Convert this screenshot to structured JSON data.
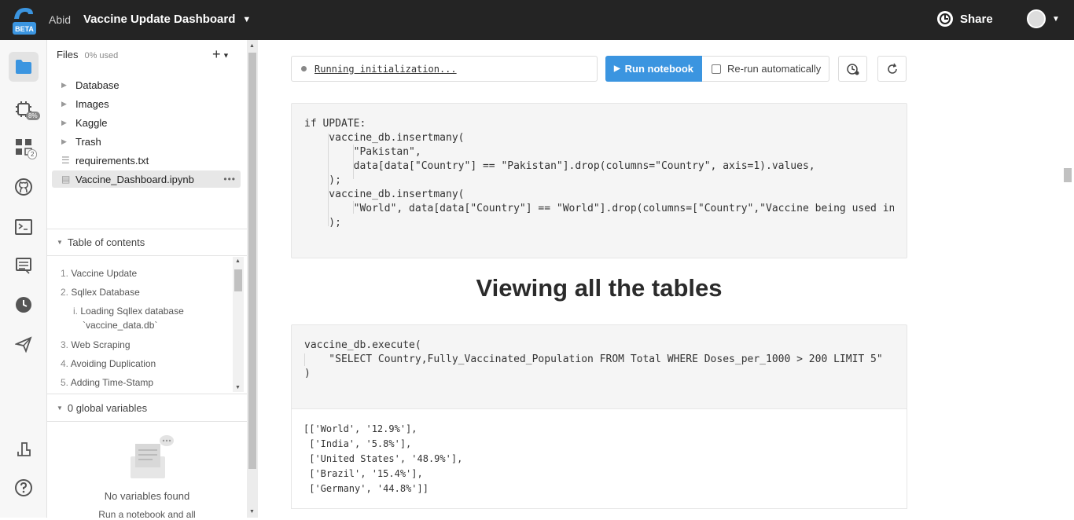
{
  "topbar": {
    "logo_label": "BETA",
    "user": "Abid",
    "doc_title": "Vaccine Update Dashboard",
    "share_label": "Share"
  },
  "rail": {
    "cpu_badge": "8%",
    "integrations_badge": "2"
  },
  "files": {
    "title": "Files",
    "used": "0% used",
    "items": [
      {
        "label": "Database",
        "type": "folder"
      },
      {
        "label": "Images",
        "type": "folder"
      },
      {
        "label": "Kaggle",
        "type": "folder"
      },
      {
        "label": "Trash",
        "type": "folder"
      },
      {
        "label": "requirements.txt",
        "type": "text-file"
      },
      {
        "label": "Vaccine_Dashboard.ipynb",
        "type": "notebook-file"
      }
    ],
    "more_label": "•••"
  },
  "toc": {
    "title": "Table of contents",
    "items": [
      {
        "num": "1.",
        "label": "Vaccine Update"
      },
      {
        "num": "2.",
        "label": "Sqllex Database"
      },
      {
        "num": "i.",
        "label": "Loading Sqllex database"
      },
      {
        "num": "",
        "label": "`vaccine_data.db`"
      },
      {
        "num": "3.",
        "label": "Web Scraping"
      },
      {
        "num": "4.",
        "label": "Avoiding Duplication"
      },
      {
        "num": "5.",
        "label": "Adding Time-Stamp"
      }
    ]
  },
  "variables": {
    "title": "0 global variables",
    "empty_title": "No variables found",
    "empty_sub": "Run a notebook and all"
  },
  "toolbar": {
    "status": "Running initialization...",
    "run_label": "Run notebook",
    "rerun_label": "Re-run automatically"
  },
  "cells": {
    "cell1_lines": [
      "if UPDATE:",
      "    vaccine_db.insertmany(",
      "        \"Pakistan\",",
      "        data[data[\"Country\"] == \"Pakistan\"].drop(columns=\"Country\", axis=1).values,",
      "    );",
      "    vaccine_db.insertmany(",
      "        \"World\", data[data[\"Country\"] == \"World\"].drop(columns=[\"Country\",\"Vaccine being used in",
      "    );"
    ],
    "heading": "Viewing all the tables",
    "cell2_lines": [
      "vaccine_db.execute(",
      "    \"SELECT Country,Fully_Vaccinated_Population FROM Total WHERE Doses_per_1000 > 200 LIMIT 5\"",
      ")"
    ],
    "output_lines": [
      "[['World', '12.9%'],",
      " ['India', '5.8%'],",
      " ['United States', '48.9%'],",
      " ['Brazil', '15.4%'],",
      " ['Germany', '44.8%']]"
    ]
  }
}
